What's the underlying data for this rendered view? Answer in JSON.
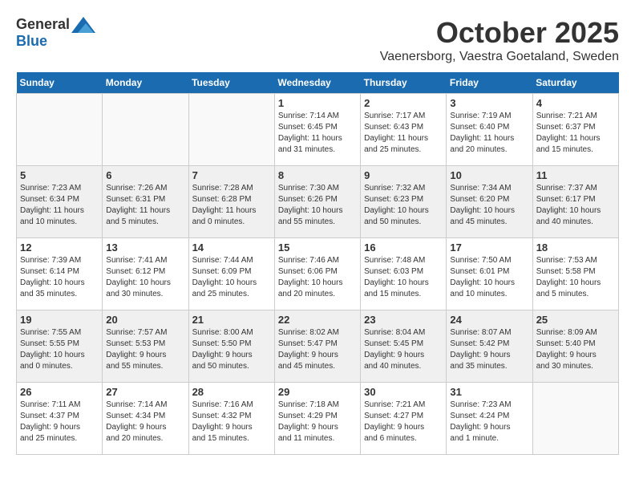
{
  "header": {
    "logo_general": "General",
    "logo_blue": "Blue",
    "month": "October 2025",
    "location": "Vaenersborg, Vaestra Goetaland, Sweden"
  },
  "weekdays": [
    "Sunday",
    "Monday",
    "Tuesday",
    "Wednesday",
    "Thursday",
    "Friday",
    "Saturday"
  ],
  "weeks": [
    [
      {
        "day": "",
        "info": ""
      },
      {
        "day": "",
        "info": ""
      },
      {
        "day": "",
        "info": ""
      },
      {
        "day": "1",
        "info": "Sunrise: 7:14 AM\nSunset: 6:45 PM\nDaylight: 11 hours\nand 31 minutes."
      },
      {
        "day": "2",
        "info": "Sunrise: 7:17 AM\nSunset: 6:43 PM\nDaylight: 11 hours\nand 25 minutes."
      },
      {
        "day": "3",
        "info": "Sunrise: 7:19 AM\nSunset: 6:40 PM\nDaylight: 11 hours\nand 20 minutes."
      },
      {
        "day": "4",
        "info": "Sunrise: 7:21 AM\nSunset: 6:37 PM\nDaylight: 11 hours\nand 15 minutes."
      }
    ],
    [
      {
        "day": "5",
        "info": "Sunrise: 7:23 AM\nSunset: 6:34 PM\nDaylight: 11 hours\nand 10 minutes."
      },
      {
        "day": "6",
        "info": "Sunrise: 7:26 AM\nSunset: 6:31 PM\nDaylight: 11 hours\nand 5 minutes."
      },
      {
        "day": "7",
        "info": "Sunrise: 7:28 AM\nSunset: 6:28 PM\nDaylight: 11 hours\nand 0 minutes."
      },
      {
        "day": "8",
        "info": "Sunrise: 7:30 AM\nSunset: 6:26 PM\nDaylight: 10 hours\nand 55 minutes."
      },
      {
        "day": "9",
        "info": "Sunrise: 7:32 AM\nSunset: 6:23 PM\nDaylight: 10 hours\nand 50 minutes."
      },
      {
        "day": "10",
        "info": "Sunrise: 7:34 AM\nSunset: 6:20 PM\nDaylight: 10 hours\nand 45 minutes."
      },
      {
        "day": "11",
        "info": "Sunrise: 7:37 AM\nSunset: 6:17 PM\nDaylight: 10 hours\nand 40 minutes."
      }
    ],
    [
      {
        "day": "12",
        "info": "Sunrise: 7:39 AM\nSunset: 6:14 PM\nDaylight: 10 hours\nand 35 minutes."
      },
      {
        "day": "13",
        "info": "Sunrise: 7:41 AM\nSunset: 6:12 PM\nDaylight: 10 hours\nand 30 minutes."
      },
      {
        "day": "14",
        "info": "Sunrise: 7:44 AM\nSunset: 6:09 PM\nDaylight: 10 hours\nand 25 minutes."
      },
      {
        "day": "15",
        "info": "Sunrise: 7:46 AM\nSunset: 6:06 PM\nDaylight: 10 hours\nand 20 minutes."
      },
      {
        "day": "16",
        "info": "Sunrise: 7:48 AM\nSunset: 6:03 PM\nDaylight: 10 hours\nand 15 minutes."
      },
      {
        "day": "17",
        "info": "Sunrise: 7:50 AM\nSunset: 6:01 PM\nDaylight: 10 hours\nand 10 minutes."
      },
      {
        "day": "18",
        "info": "Sunrise: 7:53 AM\nSunset: 5:58 PM\nDaylight: 10 hours\nand 5 minutes."
      }
    ],
    [
      {
        "day": "19",
        "info": "Sunrise: 7:55 AM\nSunset: 5:55 PM\nDaylight: 10 hours\nand 0 minutes."
      },
      {
        "day": "20",
        "info": "Sunrise: 7:57 AM\nSunset: 5:53 PM\nDaylight: 9 hours\nand 55 minutes."
      },
      {
        "day": "21",
        "info": "Sunrise: 8:00 AM\nSunset: 5:50 PM\nDaylight: 9 hours\nand 50 minutes."
      },
      {
        "day": "22",
        "info": "Sunrise: 8:02 AM\nSunset: 5:47 PM\nDaylight: 9 hours\nand 45 minutes."
      },
      {
        "day": "23",
        "info": "Sunrise: 8:04 AM\nSunset: 5:45 PM\nDaylight: 9 hours\nand 40 minutes."
      },
      {
        "day": "24",
        "info": "Sunrise: 8:07 AM\nSunset: 5:42 PM\nDaylight: 9 hours\nand 35 minutes."
      },
      {
        "day": "25",
        "info": "Sunrise: 8:09 AM\nSunset: 5:40 PM\nDaylight: 9 hours\nand 30 minutes."
      }
    ],
    [
      {
        "day": "26",
        "info": "Sunrise: 7:11 AM\nSunset: 4:37 PM\nDaylight: 9 hours\nand 25 minutes."
      },
      {
        "day": "27",
        "info": "Sunrise: 7:14 AM\nSunset: 4:34 PM\nDaylight: 9 hours\nand 20 minutes."
      },
      {
        "day": "28",
        "info": "Sunrise: 7:16 AM\nSunset: 4:32 PM\nDaylight: 9 hours\nand 15 minutes."
      },
      {
        "day": "29",
        "info": "Sunrise: 7:18 AM\nSunset: 4:29 PM\nDaylight: 9 hours\nand 11 minutes."
      },
      {
        "day": "30",
        "info": "Sunrise: 7:21 AM\nSunset: 4:27 PM\nDaylight: 9 hours\nand 6 minutes."
      },
      {
        "day": "31",
        "info": "Sunrise: 7:23 AM\nSunset: 4:24 PM\nDaylight: 9 hours\nand 1 minute."
      },
      {
        "day": "",
        "info": ""
      }
    ]
  ]
}
